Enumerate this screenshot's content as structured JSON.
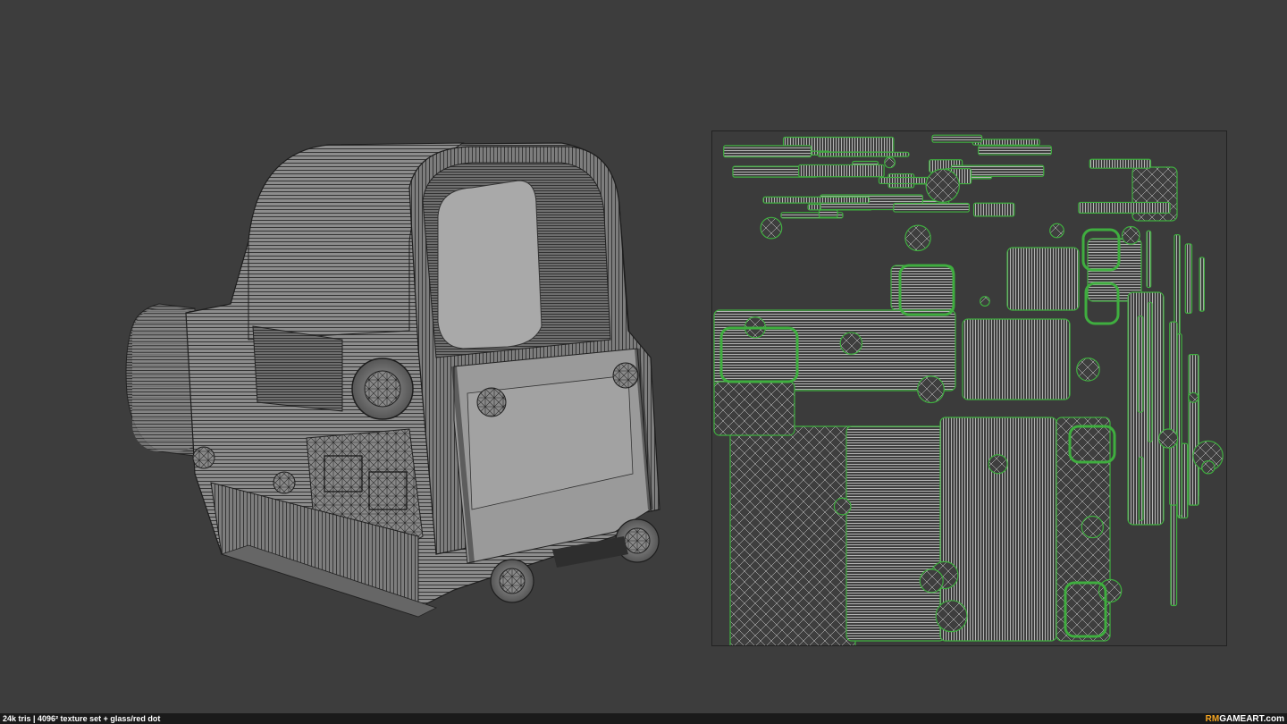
{
  "footer": {
    "caption": "24k tris | 4096² texture set + glass/red dot",
    "brand_accent": "RM",
    "brand_main": "GAMEART.com"
  },
  "colors": {
    "background": "#3d3d3d",
    "model_fill": "#8a8a8a",
    "glass": "#a8a8a8",
    "uv_wire": "#e8e8e8",
    "uv_border": "#3fa03f",
    "brand_accent": "#f5a623"
  },
  "icons": {
    "model": "holographic-sight-wireframe",
    "uv": "uv-layout-map"
  }
}
